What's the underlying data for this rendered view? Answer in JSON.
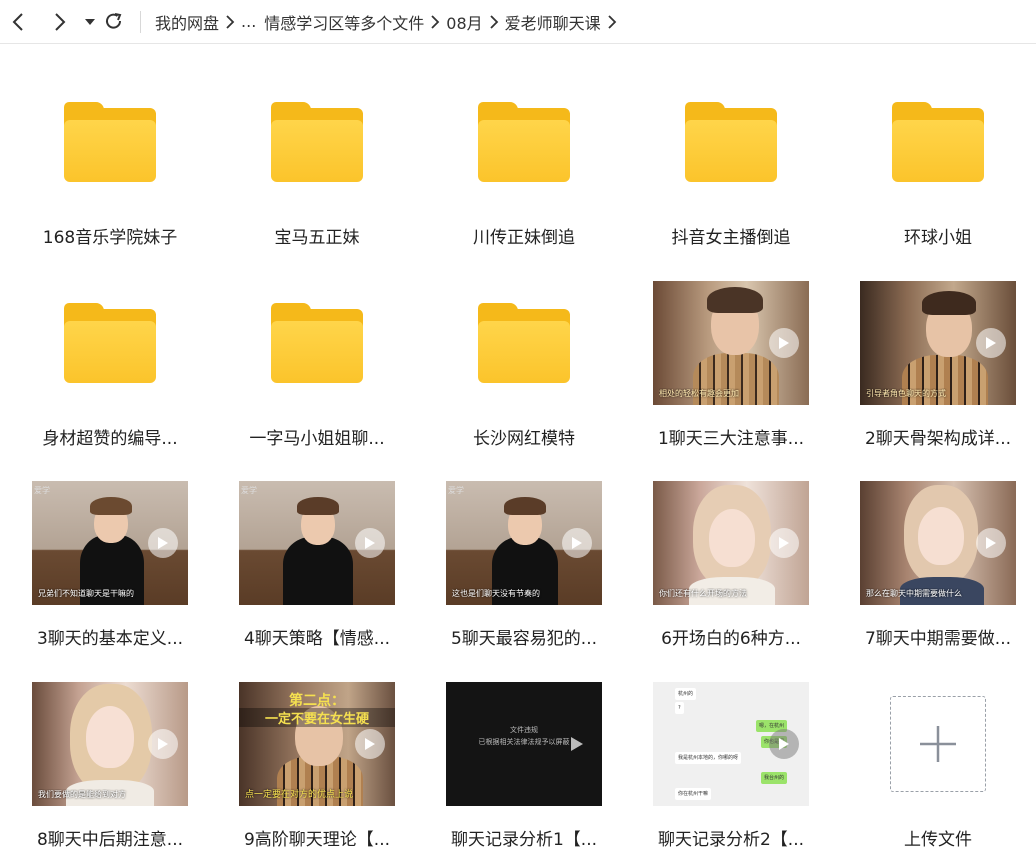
{
  "toolbar": {
    "back_icon": "chevron-left-icon",
    "forward_icon": "chevron-right-icon",
    "history_icon": "caret-down-icon",
    "refresh_icon": "refresh-icon"
  },
  "breadcrumb": [
    "我的网盘",
    "...",
    "情感学习区等多个文件",
    "08月",
    "爱老师聊天课"
  ],
  "colors": {
    "folder": "#fbc42b",
    "folder_tab": "#f5b91a"
  },
  "items": [
    {
      "type": "folder",
      "name": "168音乐学院妹子"
    },
    {
      "type": "folder",
      "name": "宝马五正妹"
    },
    {
      "type": "folder",
      "name": "川传正妹倒追"
    },
    {
      "type": "folder",
      "name": "抖音女主播倒追"
    },
    {
      "type": "folder",
      "name": "环球小姐"
    },
    {
      "type": "folder",
      "name": "身材超赞的编导..."
    },
    {
      "type": "folder",
      "name": "一字马小姐姐聊..."
    },
    {
      "type": "folder",
      "name": "长沙网红模特"
    },
    {
      "type": "video",
      "name": "1聊天三大注意事..."
    },
    {
      "type": "video",
      "name": "2聊天骨架构成详..."
    },
    {
      "type": "video",
      "name": "3聊天的基本定义..."
    },
    {
      "type": "video",
      "name": "4聊天策略【情感..."
    },
    {
      "type": "video",
      "name": "5聊天最容易犯的..."
    },
    {
      "type": "video",
      "name": "6开场白的6种方..."
    },
    {
      "type": "video",
      "name": "7聊天中期需要做..."
    },
    {
      "type": "video",
      "name": "8聊天中后期注意..."
    },
    {
      "type": "video",
      "name": "9高阶聊天理论【..."
    },
    {
      "type": "video",
      "name": "聊天记录分析1【..."
    },
    {
      "type": "video",
      "name": "聊天记录分析2【..."
    }
  ],
  "thumb_text": {
    "v3_subtitle": "兄弟们不知道聊天是干嘛的",
    "v5_subtitle": "这也是们聊天没有节奏的",
    "v9_overlay_top": "第二点：",
    "v9_overlay_mid": "一定不要在女生硬",
    "v9_overlay_bottom": "点一定要在对方的优点上说",
    "v10_caption_line1": "文件违规",
    "v10_caption_line2": "已根据相关法律法规予以屏蔽",
    "v11_chat": [
      "杭州的",
      "?",
      "嗯，在杭州",
      "你也是呢",
      "我是杭州本地的，你哪的呀",
      "我台州的",
      "你在杭州干嘛"
    ]
  },
  "upload": {
    "label": "上传文件",
    "icon": "plus-icon"
  }
}
